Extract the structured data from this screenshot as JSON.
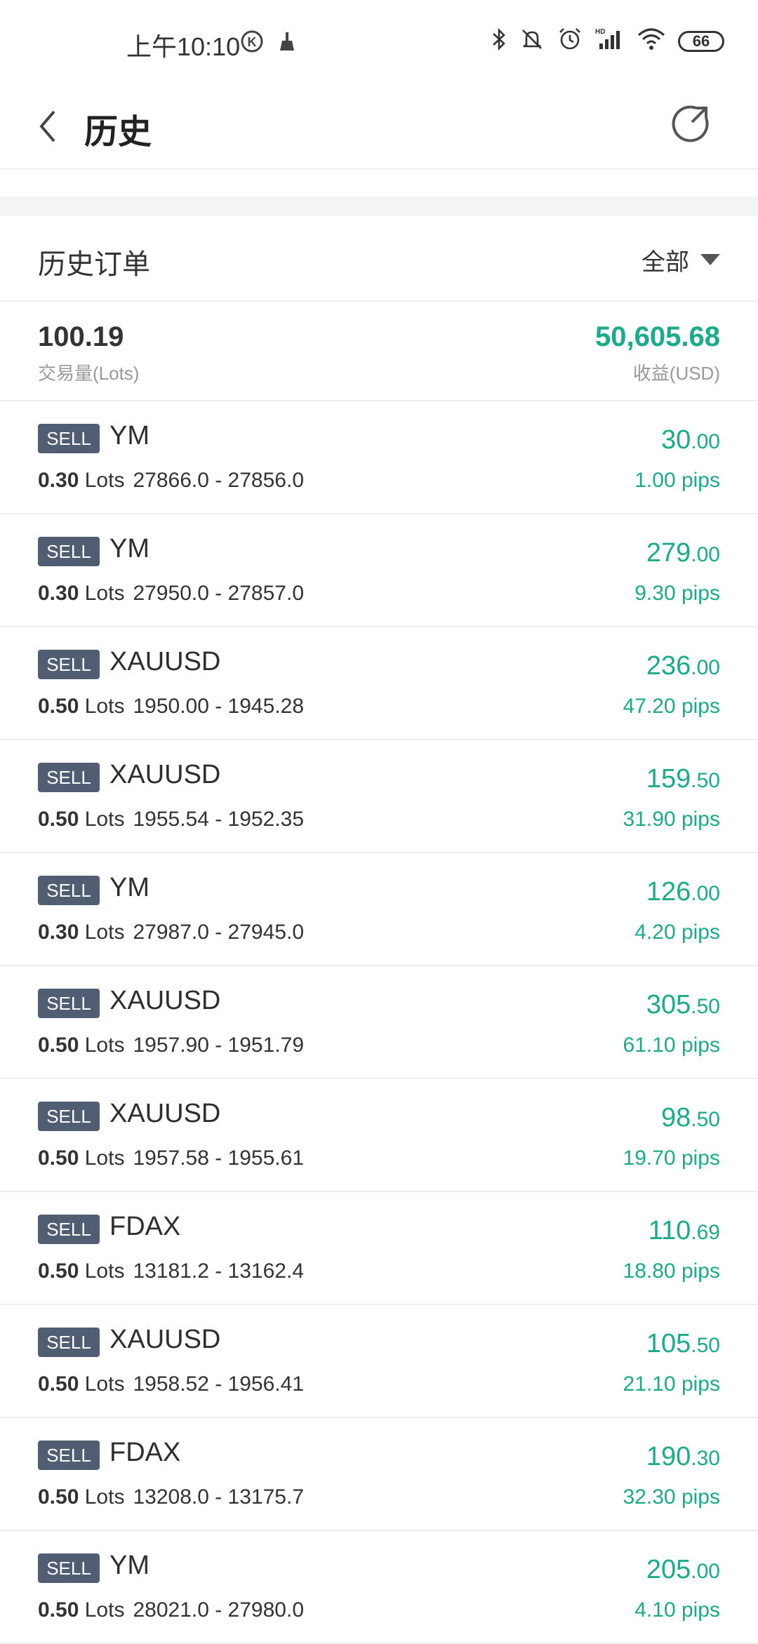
{
  "status_bar": {
    "time": "上午10:10",
    "battery": "66"
  },
  "header": {
    "title": "历史"
  },
  "section": {
    "title": "历史订单",
    "filter_label": "全部"
  },
  "summary": {
    "volume_value": "100.19",
    "volume_label": "交易量(Lots)",
    "profit_value": "50,605.68",
    "profit_label": "收益(USD)"
  },
  "colors": {
    "profit_green": "#1aab8a",
    "badge_bg": "#505d73",
    "divider": "#eeeeee"
  },
  "orders": [
    {
      "side": "SELL",
      "symbol": "YM",
      "lots": "0.30",
      "lots_unit": "Lots",
      "price_range": "27866.0 - 27856.0",
      "profit_int": "30",
      "profit_dec": ".00",
      "pips": "1.00 pips"
    },
    {
      "side": "SELL",
      "symbol": "YM",
      "lots": "0.30",
      "lots_unit": "Lots",
      "price_range": "27950.0 - 27857.0",
      "profit_int": "279",
      "profit_dec": ".00",
      "pips": "9.30 pips"
    },
    {
      "side": "SELL",
      "symbol": "XAUUSD",
      "lots": "0.50",
      "lots_unit": "Lots",
      "price_range": "1950.00 - 1945.28",
      "profit_int": "236",
      "profit_dec": ".00",
      "pips": "47.20 pips"
    },
    {
      "side": "SELL",
      "symbol": "XAUUSD",
      "lots": "0.50",
      "lots_unit": "Lots",
      "price_range": "1955.54 - 1952.35",
      "profit_int": "159",
      "profit_dec": ".50",
      "pips": "31.90 pips"
    },
    {
      "side": "SELL",
      "symbol": "YM",
      "lots": "0.30",
      "lots_unit": "Lots",
      "price_range": "27987.0 - 27945.0",
      "profit_int": "126",
      "profit_dec": ".00",
      "pips": "4.20 pips"
    },
    {
      "side": "SELL",
      "symbol": "XAUUSD",
      "lots": "0.50",
      "lots_unit": "Lots",
      "price_range": "1957.90 - 1951.79",
      "profit_int": "305",
      "profit_dec": ".50",
      "pips": "61.10 pips"
    },
    {
      "side": "SELL",
      "symbol": "XAUUSD",
      "lots": "0.50",
      "lots_unit": "Lots",
      "price_range": "1957.58 - 1955.61",
      "profit_int": "98",
      "profit_dec": ".50",
      "pips": "19.70 pips"
    },
    {
      "side": "SELL",
      "symbol": "FDAX",
      "lots": "0.50",
      "lots_unit": "Lots",
      "price_range": "13181.2 - 13162.4",
      "profit_int": "110",
      "profit_dec": ".69",
      "pips": "18.80 pips"
    },
    {
      "side": "SELL",
      "symbol": "XAUUSD",
      "lots": "0.50",
      "lots_unit": "Lots",
      "price_range": "1958.52 - 1956.41",
      "profit_int": "105",
      "profit_dec": ".50",
      "pips": "21.10 pips"
    },
    {
      "side": "SELL",
      "symbol": "FDAX",
      "lots": "0.50",
      "lots_unit": "Lots",
      "price_range": "13208.0 - 13175.7",
      "profit_int": "190",
      "profit_dec": ".30",
      "pips": "32.30 pips"
    },
    {
      "side": "SELL",
      "symbol": "YM",
      "lots": "0.50",
      "lots_unit": "Lots",
      "price_range": "28021.0 - 27980.0",
      "profit_int": "205",
      "profit_dec": ".00",
      "pips": "4.10 pips"
    }
  ]
}
